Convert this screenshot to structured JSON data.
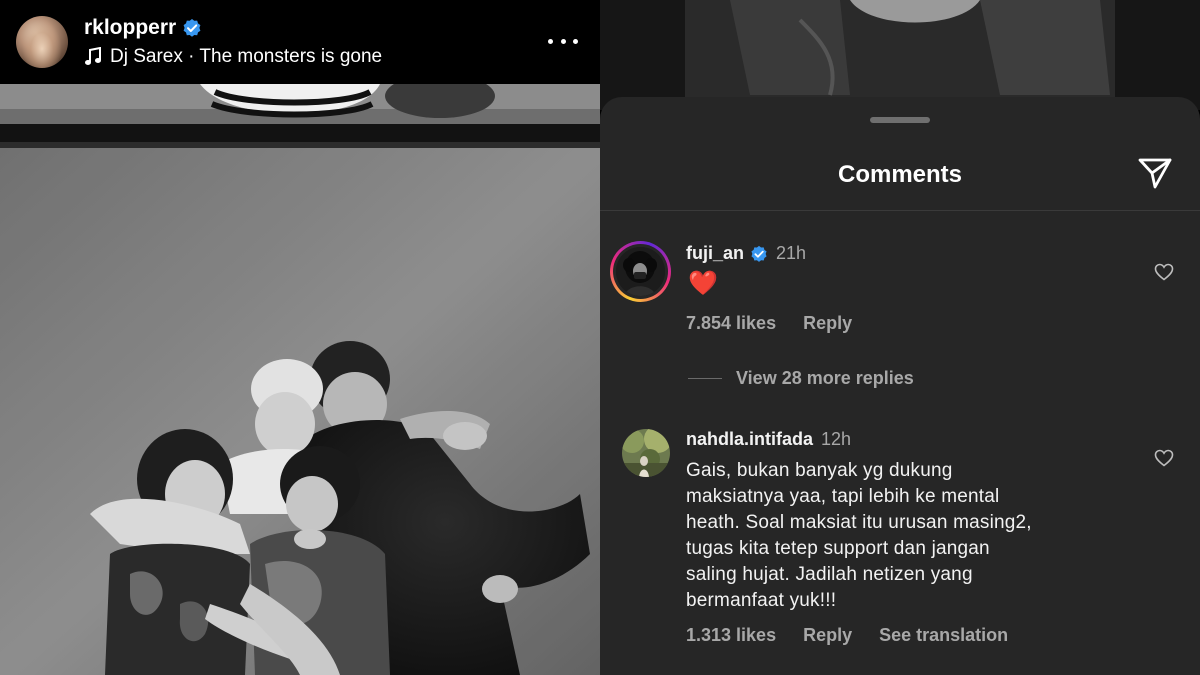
{
  "post": {
    "username": "rklopperr",
    "music": "Dj Sarex · The monsters is gone",
    "verified": true
  },
  "comments_sheet": {
    "title": "Comments"
  },
  "comments": [
    {
      "username": "fuji_an",
      "verified": true,
      "time": "21h",
      "text": "❤️",
      "likes": "7.854 likes",
      "reply_label": "Reply",
      "view_replies": "View 28 more replies"
    },
    {
      "username": "nahdla.intifada",
      "verified": false,
      "time": "12h",
      "text": "Gais, bukan banyak yg dukung\nmaksiatnya yaa, tapi lebih ke mental\nheath. Soal maksiat itu urusan masing2,\ntugas kita tetep support dan jangan\nsaling hujat. Jadilah netizen yang\nbermanfaat yuk!!!",
      "likes": "1.313 likes",
      "reply_label": "Reply",
      "translate_label": "See translation"
    }
  ],
  "icons": {
    "verified": "verified-badge-icon",
    "music": "music-note-icon",
    "more": "more-options-icon",
    "send": "send-icon",
    "heart": "heart-outline-icon"
  },
  "colors": {
    "verified_blue": "#3897f0",
    "sheet_bg": "#262626",
    "muted_text": "#a8a8a8",
    "heart_red": "#ff2d3f"
  }
}
